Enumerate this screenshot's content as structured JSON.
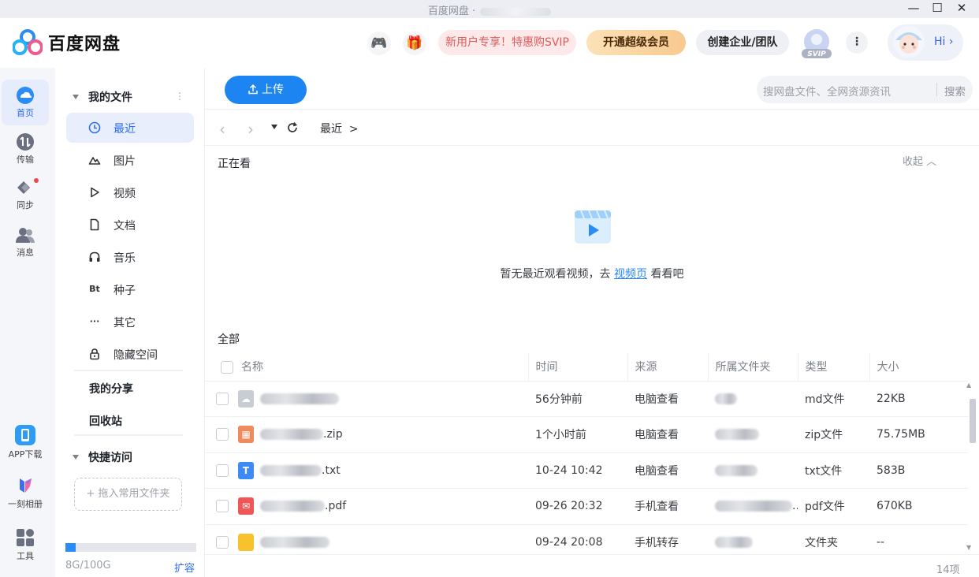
{
  "window": {
    "title": "百度网盘 ·"
  },
  "header": {
    "brand": "百度网盘",
    "promo": "新用户专享！特惠购SVIP",
    "vip_button": "开通超级会员",
    "team_button": "创建企业/团队",
    "svip_badge": "SVIP",
    "greeting": "Hi"
  },
  "rail": {
    "items": [
      {
        "label": "首页",
        "active": true
      },
      {
        "label": "传输"
      },
      {
        "label": "同步"
      },
      {
        "label": "消息"
      }
    ],
    "bottom": [
      {
        "label": "APP下载"
      },
      {
        "label": "一刻相册"
      },
      {
        "label": "工具"
      }
    ]
  },
  "sidebar": {
    "my_files": "我的文件",
    "items": [
      {
        "label": "最近",
        "icon": "clock-icon",
        "active": true
      },
      {
        "label": "图片",
        "icon": "image-icon"
      },
      {
        "label": "视频",
        "icon": "play-icon"
      },
      {
        "label": "文档",
        "icon": "document-icon"
      },
      {
        "label": "音乐",
        "icon": "headphones-icon"
      },
      {
        "label": "种子",
        "icon": "bt-icon",
        "glyph": "Bt"
      },
      {
        "label": "其它",
        "icon": "ellipsis-icon",
        "glyph": "···"
      },
      {
        "label": "隐藏空间",
        "icon": "lock-icon"
      }
    ],
    "my_share": "我的分享",
    "recycle": "回收站",
    "quick_access": "快捷访问",
    "drop_hint": "+ 拖入常用文件夹",
    "quota": "8G/100G",
    "quota_fraction": 0.08,
    "expand": "扩容"
  },
  "toolbar": {
    "upload": "上传",
    "search_placeholder": "搜网盘文件、全网资源资讯",
    "search_button": "搜索",
    "breadcrumb": "最近",
    "breadcrumb_arrow": ">"
  },
  "watching": {
    "title": "正在看",
    "collapse": "收起",
    "empty_prefix": "暂无最近观看视频，去 ",
    "empty_link": "视频页",
    "empty_suffix": " 看看吧"
  },
  "all_section": {
    "title": "全部",
    "columns": [
      "名称",
      "时间",
      "来源",
      "所属文件夹",
      "类型",
      "大小"
    ],
    "rows": [
      {
        "name_suffix": "",
        "icon": "md-file-icon",
        "color": "#c8ccd3",
        "time": "56分钟前",
        "source": "电脑查看",
        "type": "md文件",
        "size": "22KB"
      },
      {
        "name_suffix": ".zip",
        "icon": "zip-file-icon",
        "color": "#f08a5a",
        "time": "1个小时前",
        "source": "电脑查看",
        "type": "zip文件",
        "size": "75.75MB"
      },
      {
        "name_suffix": ".txt",
        "icon": "txt-file-icon",
        "color": "#3d8af7",
        "time": "10-24 10:42",
        "source": "电脑查看",
        "type": "txt文件",
        "size": "583B"
      },
      {
        "name_suffix": ".pdf",
        "icon": "pdf-file-icon",
        "color": "#f05656",
        "time": "09-26 20:32",
        "source": "手机查看",
        "folder_suffix": "..",
        "type": "pdf文件",
        "size": "670KB"
      },
      {
        "name_suffix": "",
        "icon": "folder-icon",
        "color": "#f7c22d",
        "time": "09-24 20:08",
        "source": "手机转存",
        "type": "文件夹",
        "size": "--"
      }
    ],
    "count": "14项"
  }
}
